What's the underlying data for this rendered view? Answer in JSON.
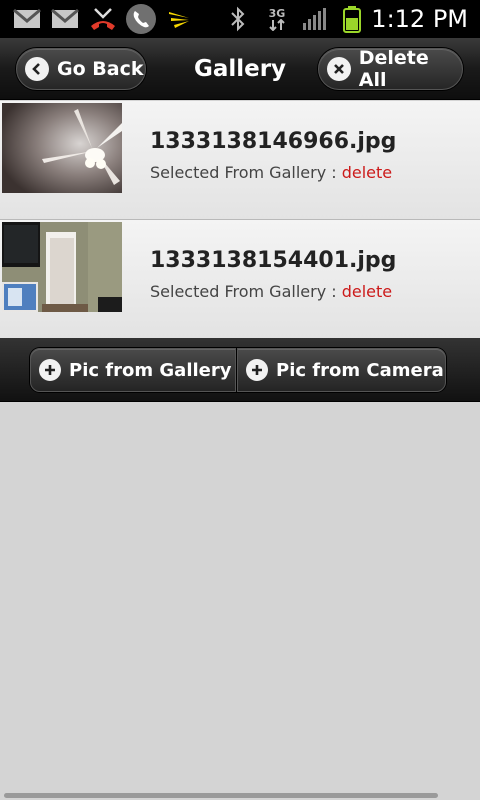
{
  "status_bar": {
    "time": "1:12 PM",
    "icons": [
      "gmail-icon",
      "gmail-icon",
      "missed-call-icon",
      "call-active-icon",
      "sprint-logo-icon",
      "bluetooth-icon",
      "3g-data-icon",
      "signal-icon",
      "battery-icon"
    ],
    "network_label": "3G"
  },
  "header": {
    "title": "Gallery",
    "back_label": "Go Back",
    "delete_all_label": "Delete All"
  },
  "gallery": {
    "items": [
      {
        "filename": "1333138146966.jpg",
        "source_text": "Selected From Gallery :",
        "delete_label": "delete",
        "thumbnail": "ceiling-fan-photo"
      },
      {
        "filename": "1333138154401.jpg",
        "source_text": "Selected From Gallery :",
        "delete_label": "delete",
        "thumbnail": "bedroom-tv-door-photo"
      }
    ]
  },
  "actions": {
    "gallery_label": "Pic from Gallery",
    "camera_label": "Pic from Camera"
  },
  "colors": {
    "delete_link": "#cc1a1a",
    "bar_bg": "#1a1a1a",
    "content_bg": "#d4d4d4"
  }
}
